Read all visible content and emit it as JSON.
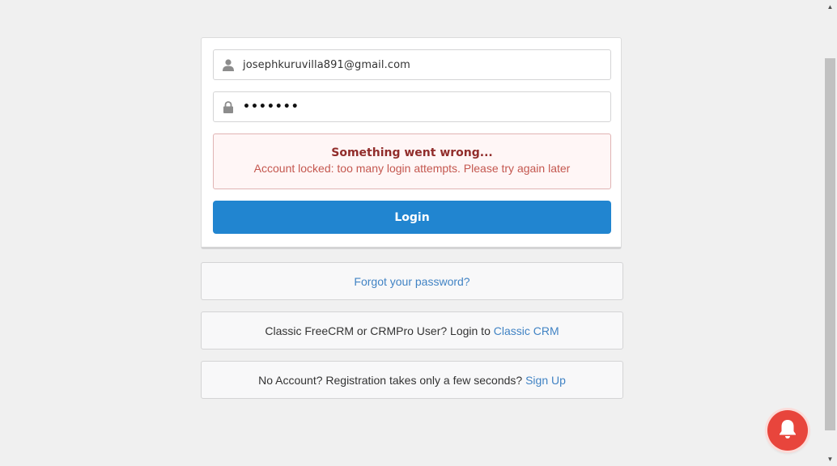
{
  "login": {
    "email_value": "josephkuruvilla891@gmail.com",
    "password_mask": "•••••••",
    "error_title": "Something went wrong...",
    "error_message": "Account locked: too many login attempts. Please try again later",
    "login_label": "Login"
  },
  "links": {
    "forgot_password": "Forgot your password?",
    "classic_prefix": "Classic FreeCRM or CRMPro User? Login to ",
    "classic_link": "Classic CRM",
    "signup_prefix": "No Account? Registration takes only a few seconds? ",
    "signup_link": "Sign Up"
  },
  "icons": {
    "email": "user-icon",
    "password": "lock-icon",
    "notify": "bell-icon"
  },
  "colors": {
    "primary": "#2185d0",
    "link": "#4183c4",
    "error_title": "#912d2b",
    "error_text": "#c4574f",
    "error_bg": "#fff6f6",
    "notify": "#e8453c"
  }
}
